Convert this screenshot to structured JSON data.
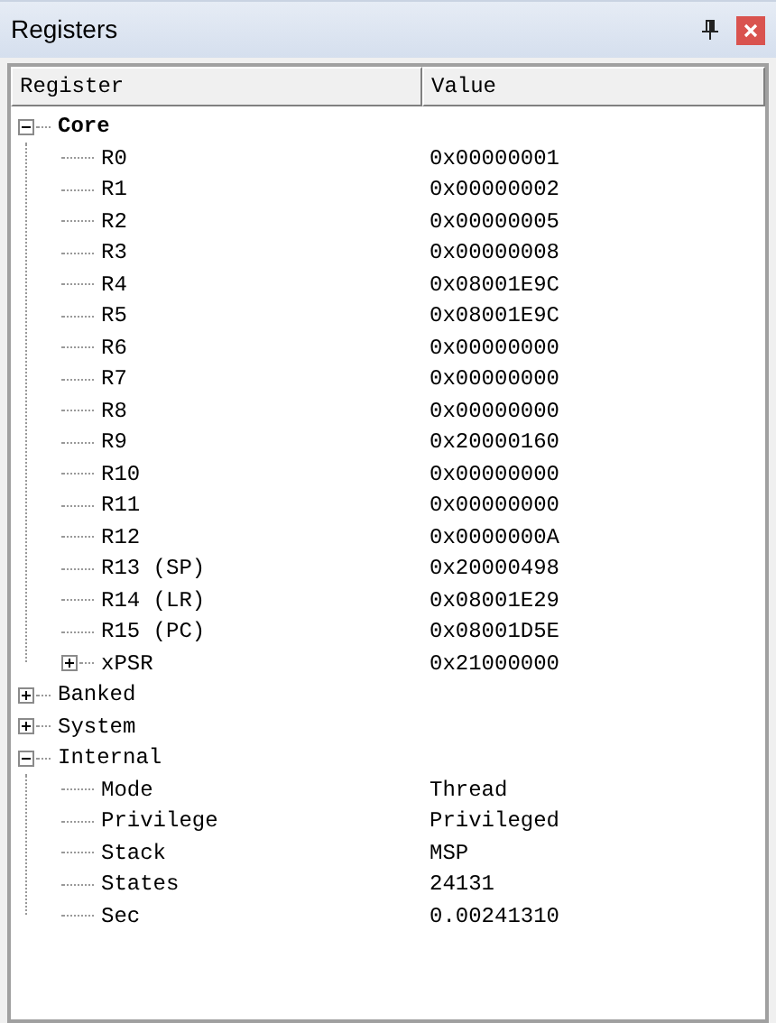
{
  "window": {
    "title": "Registers"
  },
  "columns": [
    "Register",
    "Value"
  ],
  "tree": [
    {
      "name": "Core",
      "bold": true,
      "expanded": true,
      "children": [
        {
          "name": "R0",
          "value": "0x00000001"
        },
        {
          "name": "R1",
          "value": "0x00000002"
        },
        {
          "name": "R2",
          "value": "0x00000005"
        },
        {
          "name": "R3",
          "value": "0x00000008"
        },
        {
          "name": "R4",
          "value": "0x08001E9C"
        },
        {
          "name": "R5",
          "value": "0x08001E9C"
        },
        {
          "name": "R6",
          "value": "0x00000000"
        },
        {
          "name": "R7",
          "value": "0x00000000"
        },
        {
          "name": "R8",
          "value": "0x00000000"
        },
        {
          "name": "R9",
          "value": "0x20000160"
        },
        {
          "name": "R10",
          "value": "0x00000000"
        },
        {
          "name": "R11",
          "value": "0x00000000"
        },
        {
          "name": "R12",
          "value": "0x0000000A"
        },
        {
          "name": "R13 (SP)",
          "value": "0x20000498"
        },
        {
          "name": "R14 (LR)",
          "value": "0x08001E29"
        },
        {
          "name": "R15 (PC)",
          "value": "0x08001D5E"
        },
        {
          "name": "xPSR",
          "value": "0x21000000",
          "expanded": false
        }
      ]
    },
    {
      "name": "Banked",
      "bold": false,
      "expanded": false
    },
    {
      "name": "System",
      "bold": false,
      "expanded": false
    },
    {
      "name": "Internal",
      "bold": false,
      "expanded": true,
      "children": [
        {
          "name": "Mode",
          "value": "Thread"
        },
        {
          "name": "Privilege",
          "value": "Privileged"
        },
        {
          "name": "Stack",
          "value": "MSP"
        },
        {
          "name": "States",
          "value": "24131"
        },
        {
          "name": "Sec",
          "value": "0.00241310"
        }
      ]
    }
  ]
}
